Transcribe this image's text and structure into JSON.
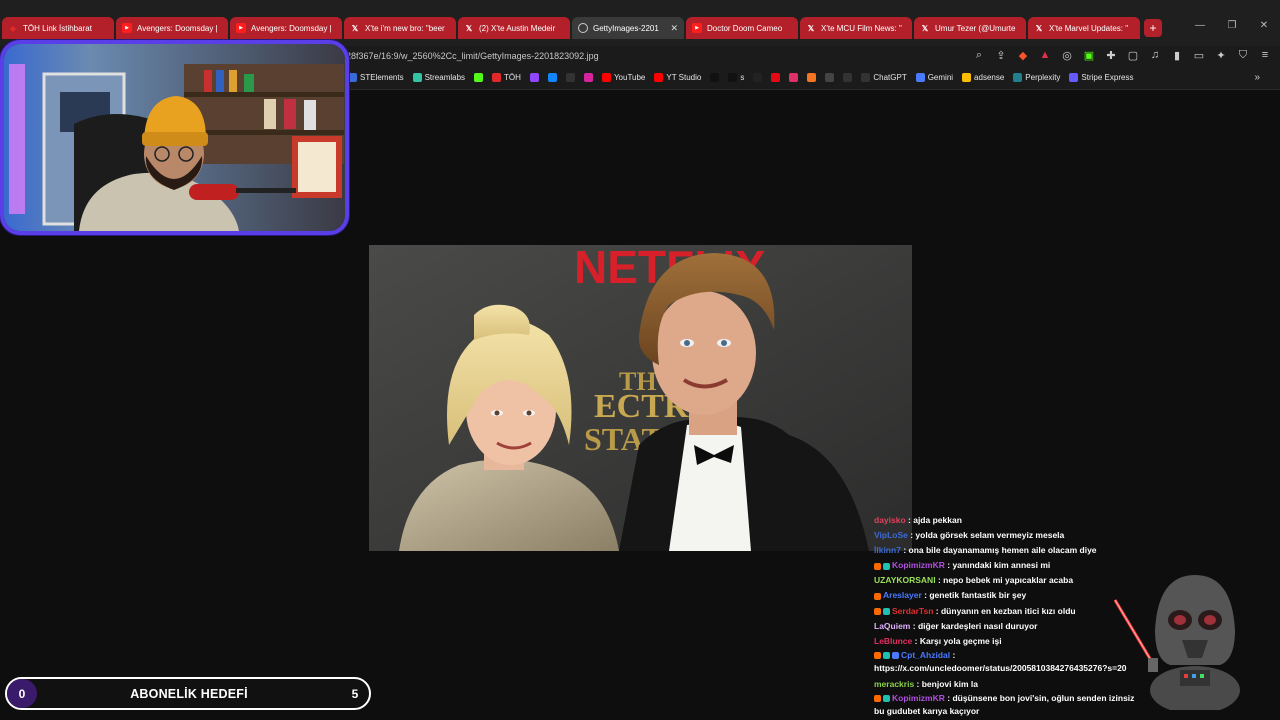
{
  "browser": {
    "tabs": [
      {
        "title": "TÖH Link İstihbarat",
        "favicon": "toh-icon",
        "color": "#e02a2a"
      },
      {
        "title": "Avengers: Doomsday |",
        "favicon": "youtube-icon"
      },
      {
        "title": "Avengers: Doomsday |",
        "favicon": "youtube-icon"
      },
      {
        "title": "X'te i'm new bro: \"beer",
        "favicon": "x-icon"
      },
      {
        "title": "(2) X'te Austin Medeir",
        "favicon": "x-icon"
      },
      {
        "title": "GettyImages-2201",
        "favicon": "globe-icon",
        "active": true
      },
      {
        "title": "Doctor Doom Cameo",
        "favicon": "youtube-icon"
      },
      {
        "title": "X'te MCU Film News: \"",
        "favicon": "x-icon"
      },
      {
        "title": "Umur Tezer (@Umurte",
        "favicon": "x-icon"
      },
      {
        "title": "X'te Marvel Updates: \"",
        "favicon": "x-icon"
      }
    ],
    "new_tab_label": "+",
    "window_controls": {
      "minimize": "—",
      "restore": "❐",
      "close": "✕"
    },
    "url": "28f367e/16:9/w_2560%2Cc_limit/GettyImages-2201823092.jpg",
    "bookmarks": [
      {
        "label": "STElements",
        "icon": "st-icon",
        "color": "#3a6ad8"
      },
      {
        "label": "Streamlabs",
        "icon": "streamlabs-icon",
        "color": "#31c3a2"
      },
      {
        "label": "",
        "icon": "kick-icon",
        "color": "#53fc18"
      },
      {
        "label": "TÖH",
        "icon": "toh-icon",
        "color": "#e02a2a"
      },
      {
        "label": "",
        "icon": "twitch-icon",
        "color": "#9146ff"
      },
      {
        "label": "",
        "icon": "bluesky-icon",
        "color": "#1185fe"
      },
      {
        "label": "",
        "icon": "x-icon",
        "color": "#333"
      },
      {
        "label": "",
        "icon": "instagram-icon",
        "color": "#d6249f"
      },
      {
        "label": "YouTube",
        "icon": "youtube-icon",
        "color": "#ff0000"
      },
      {
        "label": "YT Studio",
        "icon": "yt-studio-icon",
        "color": "#ff0000"
      },
      {
        "label": "",
        "icon": "tiktok-icon",
        "color": "#111"
      },
      {
        "label": "s",
        "icon": "tiktok-icon",
        "color": "#111"
      },
      {
        "label": "",
        "icon": "threads-icon",
        "color": "#222"
      },
      {
        "label": "",
        "icon": "netflix-icon",
        "color": "#e50914"
      },
      {
        "label": "",
        "icon": "gear-pink-icon",
        "color": "#e0306a"
      },
      {
        "label": "",
        "icon": "crunchyroll-icon",
        "color": "#f47521"
      },
      {
        "label": "",
        "icon": "amazon-icon",
        "color": "#444"
      },
      {
        "label": "",
        "icon": "zed-icon",
        "color": "#333"
      },
      {
        "label": "ChatGPT",
        "icon": "chatgpt-icon",
        "color": "#333"
      },
      {
        "label": "Gemini",
        "icon": "gemini-icon",
        "color": "#4a7bff"
      },
      {
        "label": "adsense",
        "icon": "adsense-icon",
        "color": "#fbbc04"
      },
      {
        "label": "Perplexity",
        "icon": "perplexity-icon",
        "color": "#20808d"
      },
      {
        "label": "Stripe Express",
        "icon": "stripe-icon",
        "color": "#635bff"
      }
    ],
    "more_bookmarks": "»"
  },
  "chat": {
    "messages": [
      {
        "user": "dayisko",
        "color": "#e0405a",
        "text": ": ajda pekkan"
      },
      {
        "user": "VipLoSe",
        "color": "#3a6ad8",
        "text": ": yolda görsek selam vermeyiz mesela"
      },
      {
        "user": "İlkinn7",
        "color": "#3a6ad8",
        "text": ": ona bile dayanamamış hemen aile olacam diye"
      },
      {
        "user": "KopimizmKR",
        "color": "#b050e0",
        "text": ": yanındaki kim annesi mi",
        "badges": 2
      },
      {
        "user": "UZAYKORSANI",
        "color": "#9ae05a",
        "text": ": nepo bebek mi yapıcaklar acaba"
      },
      {
        "user": "Areslayer",
        "color": "#4a7aff",
        "text": ": genetik fantastik bir şey",
        "badges": 1
      },
      {
        "user": "SerdarTsn",
        "color": "#e03030",
        "text": ": dünyanın en kezban itici kızı oldu",
        "badges": 2
      },
      {
        "user": "LaQuiem",
        "color": "#e0b0ff",
        "text": ": diğer kardeşleri nasıl duruyor"
      },
      {
        "user": "LeBlunce",
        "color": "#e03060",
        "text": ": Karşı yola geçme işi"
      },
      {
        "user": "Cpt_Ahzidal",
        "color": "#4a7aff",
        "text": ": https://x.com/uncledoomer/status/2005810384276435276?s=20",
        "badges": 3
      },
      {
        "user": "merackris",
        "color": "#8ad04a",
        "text": ": benjovi kim la"
      },
      {
        "user": "KopimizmKR",
        "color": "#b050e0",
        "text": ": düşünsene bon jovi'sin, oğlun senden izinsiz bu gudubet karıya kaçıyor",
        "badges": 2
      }
    ]
  },
  "sub_goal": {
    "current": "0",
    "label": "ABONELİK HEDEFİ",
    "target": "5"
  },
  "photo": {
    "backdrop_text_top": "NETFLIX",
    "backdrop_text_mid": "TH",
    "backdrop_text_mid2": "ECTRIC",
    "backdrop_text_bottom": "STATE"
  }
}
